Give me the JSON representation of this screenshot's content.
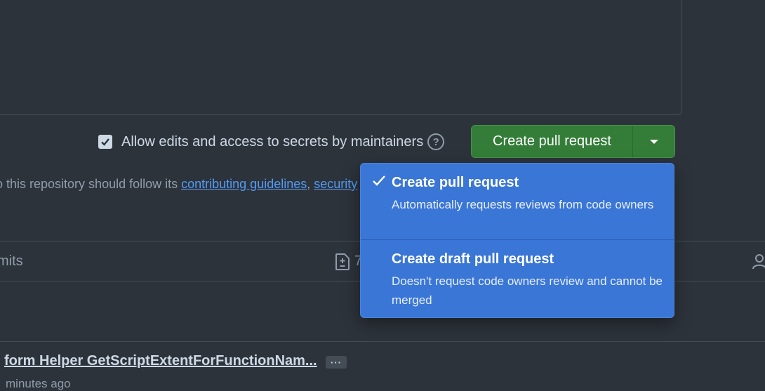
{
  "allow_edits": {
    "label": "Allow edits and access to secrets by maintainers",
    "checked": true
  },
  "help_icon": "question-circle-icon",
  "create_button": {
    "label": "Create pull request"
  },
  "guidelines": {
    "prefix": "o this repository should follow its ",
    "link1": "contributing guidelines",
    "comma": ", ",
    "link2": "security"
  },
  "tabs": {
    "commits": "mits",
    "files_count": "7"
  },
  "commit": {
    "title": "form Helper GetScriptExtentForFunctionNam...",
    "ellipsis": "···",
    "time": "minutes ago"
  },
  "dropdown": {
    "items": [
      {
        "title": "Create pull request",
        "description": "Automatically requests reviews from code owners",
        "selected": true
      },
      {
        "title": "Create draft pull request",
        "description": "Doesn't request code owners review and cannot be merged",
        "selected": false
      }
    ]
  }
}
